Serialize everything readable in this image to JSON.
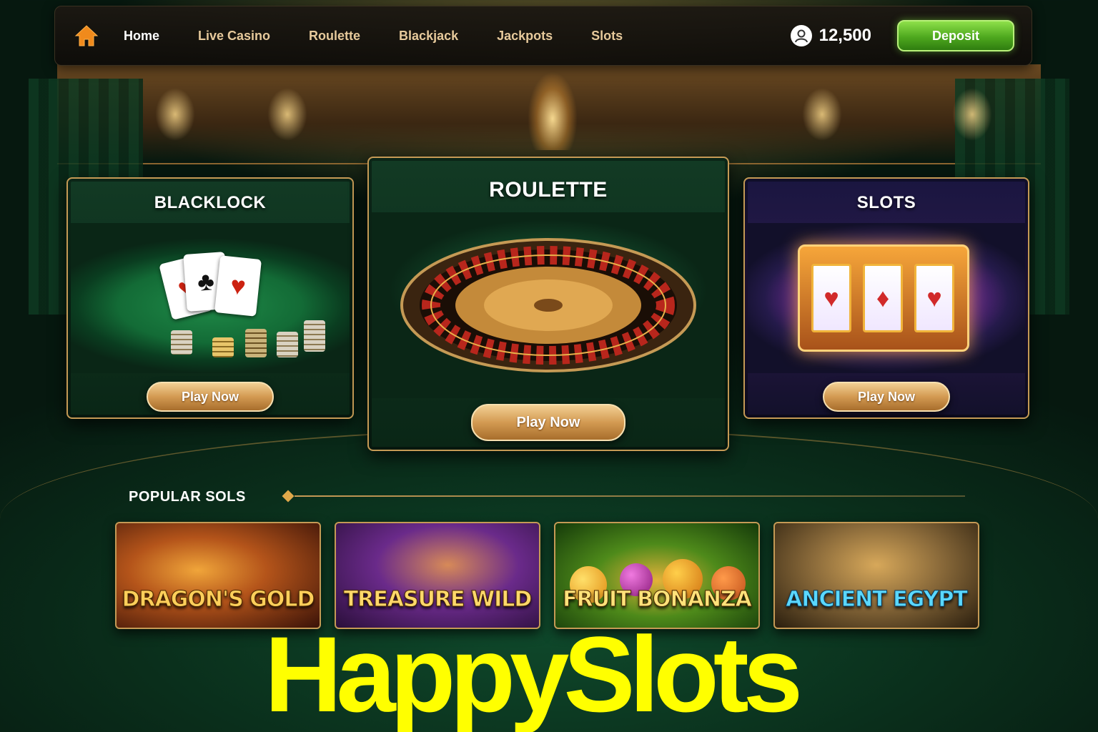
{
  "nav": {
    "items": [
      "Home",
      "Live Casino",
      "Roulette",
      "Blackjack",
      "Jackpots",
      "Slots"
    ],
    "balance": "12,500",
    "deposit_label": "Deposit"
  },
  "featured": [
    {
      "title": "BLACKLOCK",
      "button": "Play Now"
    },
    {
      "title": "ROULETTE",
      "button": "Play Now"
    },
    {
      "title": "SLOTS",
      "button": "Play Now"
    }
  ],
  "popular": {
    "title": "POPULAR SOLS",
    "games": [
      "DRAGON'S GOLD",
      "TREASURE WILD",
      "FRUIT BONANZA",
      "ANCIENT EGYPT"
    ]
  },
  "brand": "HappySlots",
  "colors": {
    "accent_gold": "#c59a55",
    "deposit_green": "#4ea81e",
    "nav_orange": "#f08a1c",
    "felt_green": "#136b36",
    "brand_yellow": "#ffff00"
  },
  "icons": {
    "home": "home-icon",
    "balance": "user-avatar-icon"
  }
}
